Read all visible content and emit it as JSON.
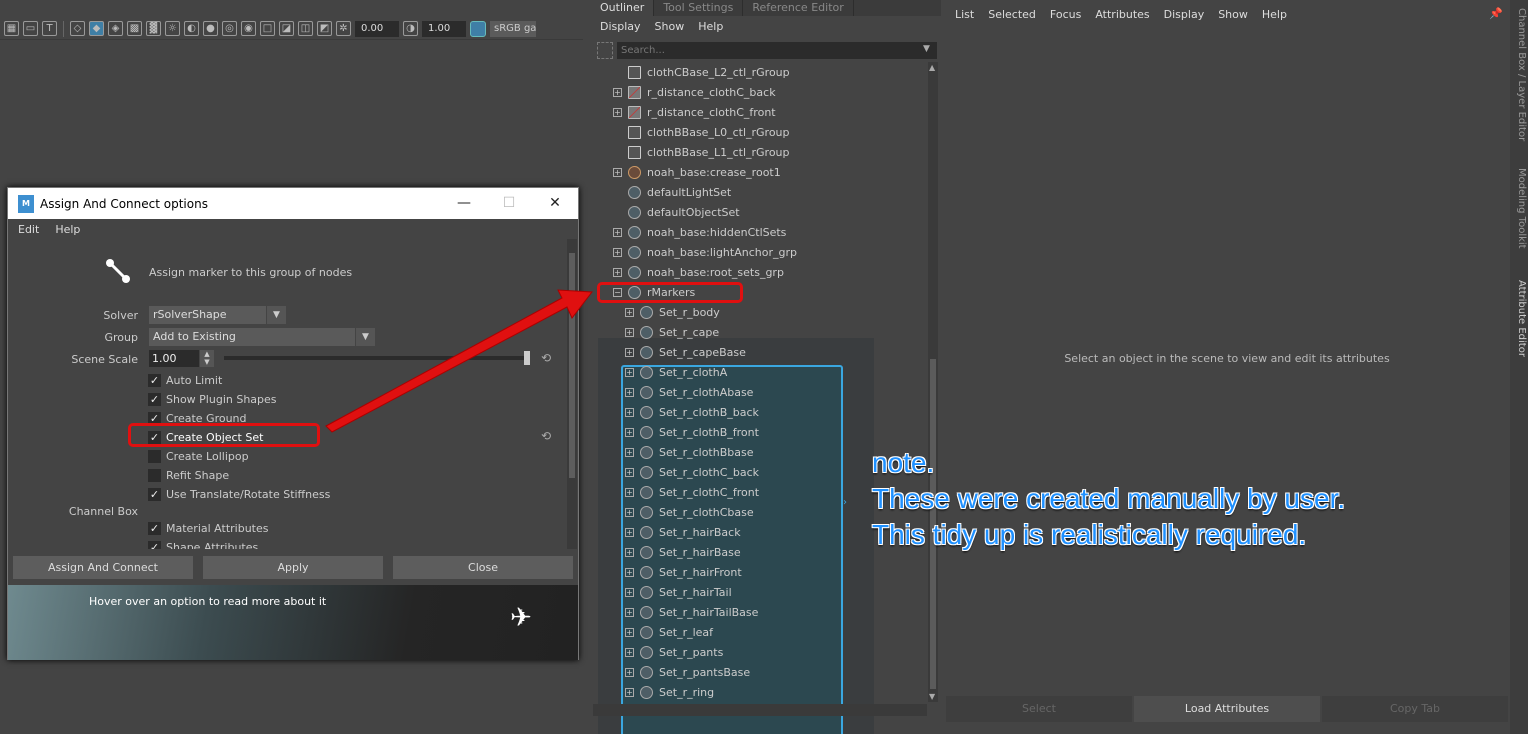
{
  "toolbar": {
    "value_a": "0.00",
    "value_b": "1.00",
    "color_space": "sRGB gamma"
  },
  "dialog": {
    "title": "Assign And Connect options",
    "menu": [
      "Edit",
      "Help"
    ],
    "description": "Assign marker to this group of nodes",
    "solver_label": "Solver",
    "solver_value": "rSolverShape",
    "group_label": "Group",
    "group_value": "Add to Existing",
    "scene_scale_label": "Scene Scale",
    "scene_scale_value": "1.00",
    "checkboxes": [
      {
        "label": "Auto Limit",
        "checked": true
      },
      {
        "label": "Show Plugin Shapes",
        "checked": true
      },
      {
        "label": "Create Ground",
        "checked": true
      },
      {
        "label": "Create Object Set",
        "checked": true
      },
      {
        "label": "Create Lollipop",
        "checked": false
      },
      {
        "label": "Refit Shape",
        "checked": false
      },
      {
        "label": "Use Translate/Rotate Stiffness",
        "checked": true
      }
    ],
    "channel_box_label": "Channel Box",
    "channel_checkboxes": [
      {
        "label": "Material Attributes",
        "checked": true
      },
      {
        "label": "Shape Attributes",
        "checked": true
      }
    ],
    "buttons": {
      "assign": "Assign And Connect",
      "apply": "Apply",
      "close": "Close"
    },
    "footer_text": "Hover over an option to read more about it"
  },
  "outliner": {
    "tabs": [
      "Outliner",
      "Tool Settings",
      "Reference Editor"
    ],
    "menu": [
      "Display",
      "Show",
      "Help"
    ],
    "search_placeholder": "Search...",
    "items": [
      {
        "label": "clothCBase_L2_ctl_rGroup",
        "expandable": false,
        "icon": "group"
      },
      {
        "label": "r_distance_clothC_back",
        "expandable": true,
        "icon": "distance"
      },
      {
        "label": "r_distance_clothC_front",
        "expandable": true,
        "icon": "distance"
      },
      {
        "label": "clothBBase_L0_ctl_rGroup",
        "expandable": false,
        "icon": "group"
      },
      {
        "label": "clothBBase_L1_ctl_rGroup",
        "expandable": false,
        "icon": "group"
      },
      {
        "label": "noah_base:crease_root1",
        "expandable": true,
        "icon": "crease"
      },
      {
        "label": "defaultLightSet",
        "expandable": false,
        "icon": "set"
      },
      {
        "label": "defaultObjectSet",
        "expandable": false,
        "icon": "set"
      },
      {
        "label": "noah_base:hiddenCtlSets",
        "expandable": true,
        "icon": "set"
      },
      {
        "label": "noah_base:lightAnchor_grp",
        "expandable": true,
        "icon": "set"
      },
      {
        "label": "noah_base:root_sets_grp",
        "expandable": true,
        "icon": "set"
      },
      {
        "label": "rMarkers",
        "expandable": true,
        "icon": "set",
        "expanded": true
      }
    ],
    "children": [
      "Set_r_body",
      "Set_r_cape",
      "Set_r_capeBase",
      "Set_r_clothA",
      "Set_r_clothAbase",
      "Set_r_clothB_back",
      "Set_r_clothB_front",
      "Set_r_clothBbase",
      "Set_r_clothC_back",
      "Set_r_clothC_front",
      "Set_r_clothCbase",
      "Set_r_hairBack",
      "Set_r_hairBase",
      "Set_r_hairFront",
      "Set_r_hairTail",
      "Set_r_hairTailBase",
      "Set_r_leaf",
      "Set_r_pants",
      "Set_r_pantsBase",
      "Set_r_ring"
    ]
  },
  "attribute_editor": {
    "menu": [
      "List",
      "Selected",
      "Focus",
      "Attributes",
      "Display",
      "Show",
      "Help"
    ],
    "message": "Select an object in the scene to view and edit its attributes",
    "buttons": [
      "Select",
      "Load Attributes",
      "Copy Tab"
    ]
  },
  "side_tabs": [
    "Channel Box / Layer Editor",
    "Modeling Toolkit",
    "Attribute Editor"
  ],
  "annotation": {
    "lines": [
      "note.",
      "These were created manually by user.",
      "This tidy up is realistically required."
    ],
    "color": "#1e90ff"
  },
  "colors": {
    "highlight_red": "#e01010",
    "set_border": "#3aa7e0"
  }
}
